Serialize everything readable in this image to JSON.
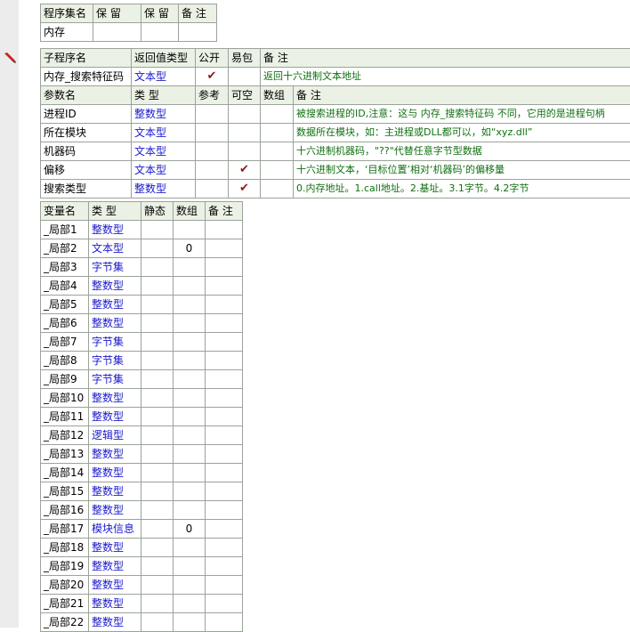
{
  "assembly_table": {
    "headers": [
      "程序集名",
      "保 留",
      "保 留",
      "备 注"
    ],
    "row": [
      "内存",
      "",
      "",
      ""
    ]
  },
  "sub_table": {
    "headers": [
      "子程序名",
      "返回值类型",
      "公开",
      "易包",
      "备 注"
    ],
    "row": {
      "name": "内存_搜索特征码",
      "return_type": "文本型",
      "public": "✔",
      "easy_pkg": "",
      "note": "返回十六进制文本地址"
    }
  },
  "param_table": {
    "headers": [
      "参数名",
      "类 型",
      "参考",
      "可空",
      "数组",
      "备 注"
    ],
    "rows": [
      {
        "name": "进程ID",
        "type": "整数型",
        "ref": "",
        "nullable": "",
        "array": "",
        "note": "被搜索进程的ID,注意：这与 内存_搜索特征码 不同，它用的是进程句柄"
      },
      {
        "name": "所在模块",
        "type": "文本型",
        "ref": "",
        "nullable": "",
        "array": "",
        "note": "数据所在模块，如：主进程或DLL都可以，如“xyz.dll”"
      },
      {
        "name": "机器码",
        "type": "文本型",
        "ref": "",
        "nullable": "",
        "array": "",
        "note": "十六进制机器码，\"??\"代替任意字节型数据"
      },
      {
        "name": "偏移",
        "type": "文本型",
        "ref": "",
        "nullable": "✔",
        "array": "",
        "note": "十六进制文本，‘目标位置’相对‘机器码’的偏移量"
      },
      {
        "name": "搜索类型",
        "type": "整数型",
        "ref": "",
        "nullable": "✔",
        "array": "",
        "note": "0.内存地址。1.call地址。2.基址。3.1字节。4.2字节"
      }
    ]
  },
  "var_table": {
    "headers": [
      "变量名",
      "类 型",
      "静态",
      "数组",
      "备 注"
    ],
    "rows": [
      {
        "name": "_局部1",
        "type": "整数型",
        "static": "",
        "array": ""
      },
      {
        "name": "_局部2",
        "type": "文本型",
        "static": "",
        "array": "0"
      },
      {
        "name": "_局部3",
        "type": "字节集",
        "static": "",
        "array": ""
      },
      {
        "name": "_局部4",
        "type": "整数型",
        "static": "",
        "array": ""
      },
      {
        "name": "_局部5",
        "type": "整数型",
        "static": "",
        "array": ""
      },
      {
        "name": "_局部6",
        "type": "整数型",
        "static": "",
        "array": ""
      },
      {
        "name": "_局部7",
        "type": "字节集",
        "static": "",
        "array": ""
      },
      {
        "name": "_局部8",
        "type": "字节集",
        "static": "",
        "array": ""
      },
      {
        "name": "_局部9",
        "type": "字节集",
        "static": "",
        "array": ""
      },
      {
        "name": "_局部10",
        "type": "整数型",
        "static": "",
        "array": ""
      },
      {
        "name": "_局部11",
        "type": "整数型",
        "static": "",
        "array": ""
      },
      {
        "name": "_局部12",
        "type": "逻辑型",
        "static": "",
        "array": ""
      },
      {
        "name": "_局部13",
        "type": "整数型",
        "static": "",
        "array": ""
      },
      {
        "name": "_局部14",
        "type": "整数型",
        "static": "",
        "array": ""
      },
      {
        "name": "_局部15",
        "type": "整数型",
        "static": "",
        "array": ""
      },
      {
        "name": "_局部16",
        "type": "整数型",
        "static": "",
        "array": ""
      },
      {
        "name": "_局部17",
        "type": "模块信息",
        "static": "",
        "array": "0"
      },
      {
        "name": "_局部18",
        "type": "整数型",
        "static": "",
        "array": ""
      },
      {
        "name": "_局部19",
        "type": "整数型",
        "static": "",
        "array": ""
      },
      {
        "name": "_局部20",
        "type": "整数型",
        "static": "",
        "array": ""
      },
      {
        "name": "_局部21",
        "type": "整数型",
        "static": "",
        "array": ""
      },
      {
        "name": "_局部22",
        "type": "整数型",
        "static": "",
        "array": ""
      }
    ]
  },
  "icons": {
    "gutter": "pencil-icon",
    "check": "checkmark-icon"
  }
}
